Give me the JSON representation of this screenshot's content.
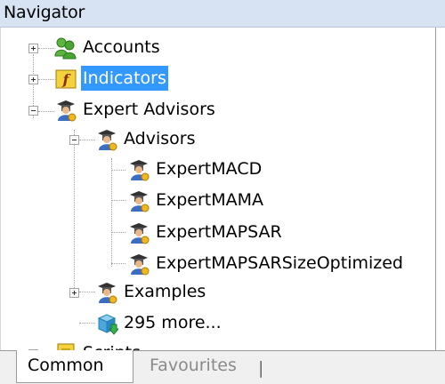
{
  "window": {
    "title": "Navigator"
  },
  "tree": {
    "accounts": "Accounts",
    "indicators": "Indicators",
    "expert_advisors": "Expert Advisors",
    "advisors": "Advisors",
    "expert_macd": "ExpertMACD",
    "expert_mama": "ExpertMAMA",
    "expert_mapsar": "ExpertMAPSAR",
    "expert_mapsar_size": "ExpertMAPSARSizeOptimized",
    "examples": "Examples",
    "more": "295 more...",
    "scripts": "Scripts"
  },
  "tabs": {
    "common": "Common",
    "favourites": "Favourites",
    "separator": "|"
  },
  "colors": {
    "selection": "#3399ff",
    "title_bar": "#d7e3f3"
  },
  "icons": [
    "accounts-icon",
    "indicator-icon",
    "expert-advisor-icon",
    "script-icon",
    "more-icon"
  ]
}
